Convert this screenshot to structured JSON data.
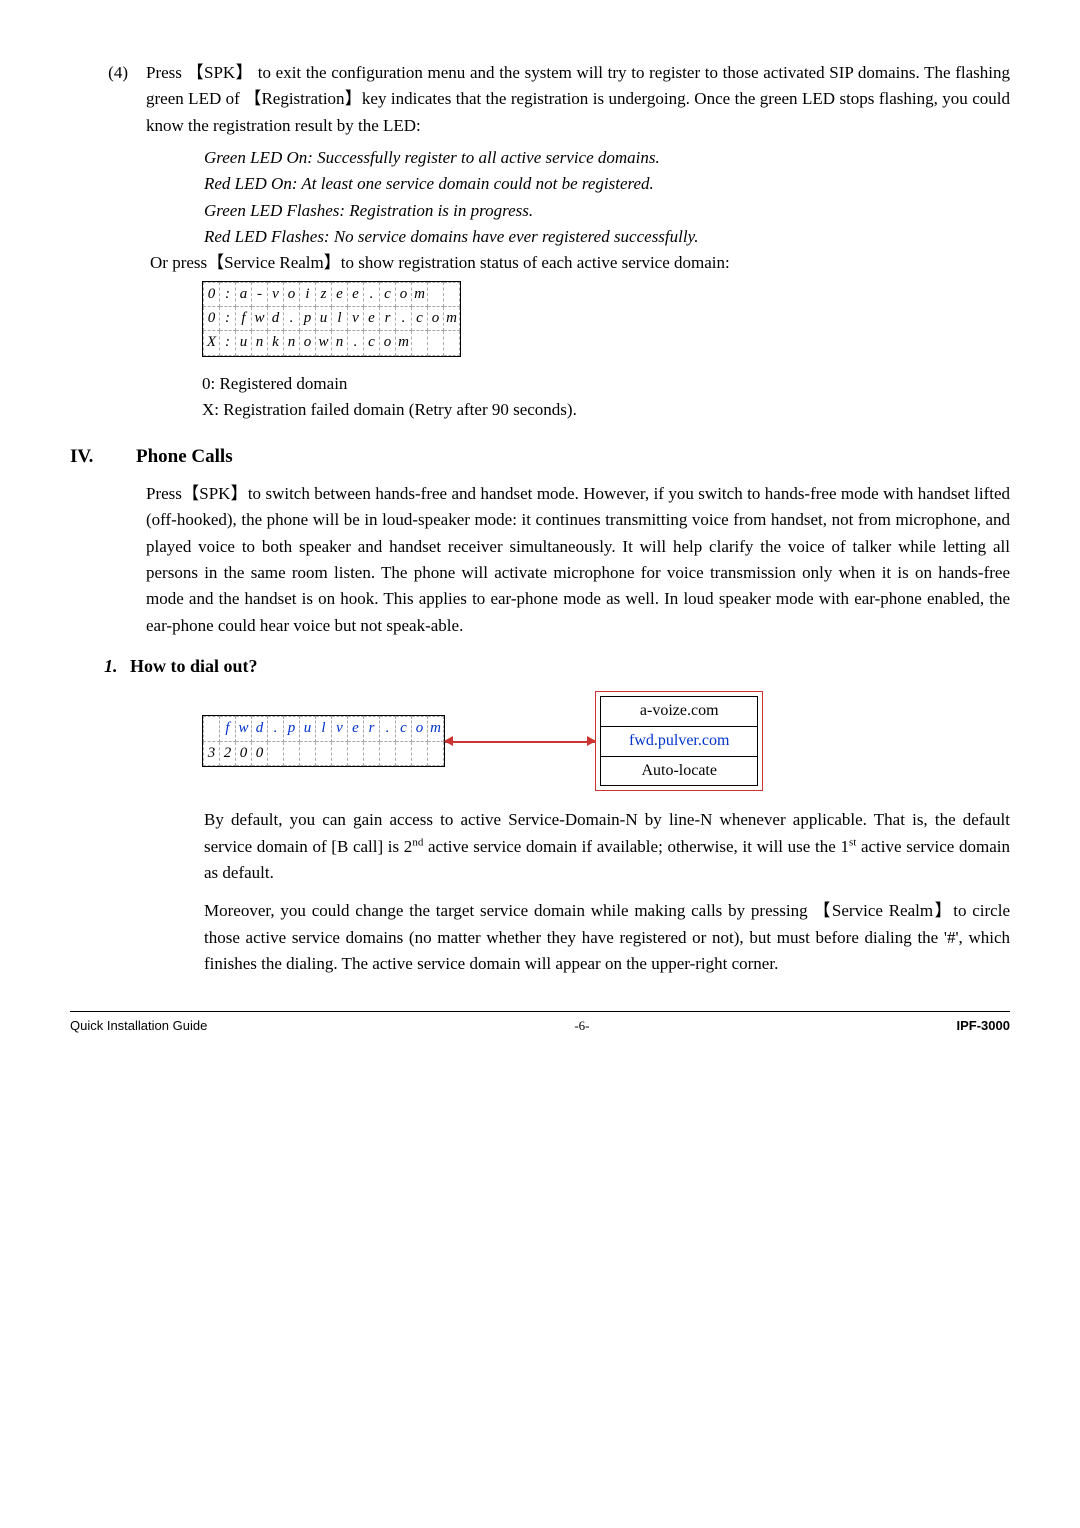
{
  "item4": {
    "marker": "(4)",
    "text_a": "Press  ",
    "key1": "【SPK】",
    "text_b": "  to exit the configuration menu and the system will try to register to those activated SIP domains. The flashing green LED of  ",
    "key2": "【Registration】",
    "text_c": "key indicates that the registration is undergoing. Once the green LED stops flashing, you could know the registration result by the LED:"
  },
  "led_lines": {
    "l1": "Green LED On: Successfully register to all active service domains.",
    "l2": "Red LED On: At least one service domain could not be registered.",
    "l3": "Green LED Flashes: Registration is in progress.",
    "l4": "Red LED Flashes: No service domains have ever registered successfully."
  },
  "or_press": {
    "a": "Or press",
    "key": "【Service Realm】",
    "b": "to show registration status of each active service domain:"
  },
  "lcd1": {
    "r1": [
      "0",
      ":",
      "a",
      "-",
      "v",
      "o",
      "i",
      "z",
      "e",
      "e",
      ".",
      "c",
      "o",
      "m",
      "",
      "",
      ""
    ],
    "r2": [
      "0",
      ":",
      "f",
      "w",
      "d",
      ".",
      "p",
      "u",
      "l",
      "v",
      "e",
      "r",
      ".",
      "c",
      "o",
      "m"
    ],
    "r3": [
      "X",
      ":",
      "u",
      "n",
      "k",
      "n",
      "o",
      "w",
      "n",
      ".",
      "c",
      "o",
      "m",
      "",
      "",
      "",
      ""
    ]
  },
  "notes": {
    "n1": "0: Registered domain",
    "n2": "X: Registration failed domain (Retry after 90 seconds)."
  },
  "sec4": {
    "num": "IV.",
    "title": "Phone Calls"
  },
  "phone_para": {
    "a": "Press",
    "key": "【SPK】",
    "b": "to switch between hands-free and handset mode. However, if you switch to hands-free mode with handset lifted (off-hooked), the phone will be in loud-speaker mode: it continues transmitting voice from handset, not from microphone, and played voice to both speaker and handset receiver simultaneously. It will help clarify the voice of talker while letting all persons in the same room listen. The phone will activate microphone for voice transmission only when it is on hands-free mode and the handset is on hook. This applies to ear-phone mode as well. In loud speaker mode with ear-phone enabled, the ear-phone could hear voice but not speak-able."
  },
  "sub1": {
    "num": "1.",
    "title": "How to dial out?"
  },
  "dial_lcd": {
    "r1": [
      "",
      "f",
      "w",
      "d",
      ".",
      "p",
      "u",
      "l",
      "v",
      "e",
      "r",
      ".",
      "c",
      "o",
      "m"
    ],
    "r2": [
      "3",
      "2",
      "0",
      "0",
      "",
      "",
      "",
      "",
      "",
      "",
      "",
      "",
      "",
      "",
      ""
    ]
  },
  "domain_list": {
    "r1": "a-voize.com",
    "r2": "fwd.pulver.com",
    "r3": "Auto-locate"
  },
  "dial_para1": {
    "a": "By default, you can gain access to active Service-Domain-N by line-N whenever applicable. That is, the default service domain of [B call] is 2",
    "sup1": "nd",
    "b": " active service domain if available; otherwise, it will use the 1",
    "sup2": "st",
    "c": " active service domain as default."
  },
  "dial_para2": {
    "a": "Moreover, you could change the target service domain while making calls by pressing ",
    "key": "【Service Realm】",
    "b": "to circle those active service domains (no matter whether they have registered or not), but must before dialing the '#', which finishes the dialing. The active service domain will appear on the upper-right corner."
  },
  "footer": {
    "left": "Quick Installation Guide",
    "mid": "-6-",
    "right": "IPF-3000"
  }
}
